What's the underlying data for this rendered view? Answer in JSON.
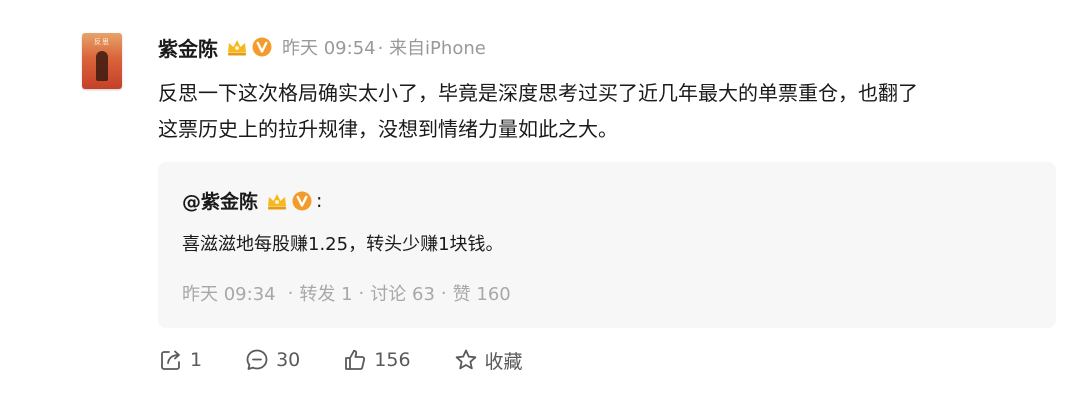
{
  "post": {
    "username": "紫金陈",
    "time": "昨天 09:54",
    "source": "· 来自iPhone",
    "text_line1": "反思一下这次格局确实太小了，毕竟是深度思考过买了近几年最大的单票重仓，也翻了",
    "text_line2": "这票历史上的拉升规律，没想到情绪力量如此之大。",
    "avatar_cover_text": "反思"
  },
  "quote": {
    "username": "@紫金陈",
    "colon": ":",
    "text": "喜滋滋地每股赚1.25，转头少赚1块钱。",
    "time": "昨天 09:34",
    "reposts": "转发 1",
    "comments": "讨论 63",
    "likes": "赞 160",
    "separator": "·"
  },
  "actions": {
    "share_count": "1",
    "comment_count": "30",
    "like_count": "156",
    "favorite_label": "收藏"
  },
  "colors": {
    "badge_gold": "#f5b81f",
    "vip_orange": "#f39c2c",
    "meta_gray": "#999999"
  },
  "icons": [
    "crown-icon",
    "vip-badge-icon",
    "share-icon",
    "comment-icon",
    "like-icon",
    "star-icon"
  ]
}
